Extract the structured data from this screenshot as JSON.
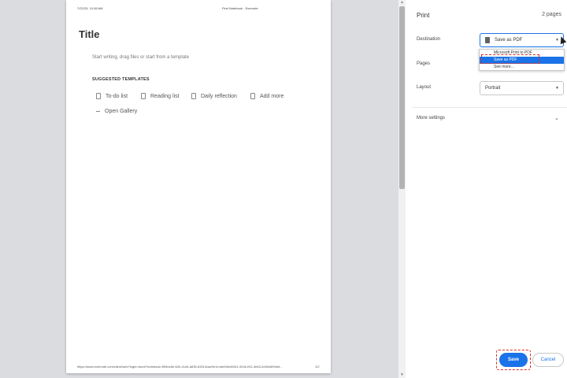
{
  "preview": {
    "header_date": "7/22/25, 10:38 AM",
    "header_title": "First Notebook - Evernote",
    "title": "Title",
    "hint": "Start writing, drag files or start from a template",
    "suggested_heading": "SUGGESTED TEMPLATES",
    "templates": [
      "To-do list",
      "Reading list",
      "Daily reflection",
      "Add more"
    ],
    "open_gallery": "Open Gallery",
    "footer_url": "https://www.evernote.com/client/web?login=true#?notebook=f0f4bc6e-62b-41d4-a635-83013cae9e1/note/06e40611-924e-ff11-3e63-2e63c6f94e6...",
    "footer_page": "1/2"
  },
  "panel": {
    "title": "Print",
    "pages_count": "2 pages",
    "destination_label": "Destination",
    "destination_value": "Save as PDF",
    "pages_label": "Pages",
    "layout_label": "Layout",
    "layout_value": "Portrait",
    "more_settings": "More settings",
    "dropdown_options": [
      "Microsoft Print to PDF",
      "Save as PDF",
      "See more..."
    ],
    "save_label": "Save",
    "cancel_label": "Cancel"
  },
  "colors": {
    "accent": "#1a73e8",
    "highlight": "#d93025"
  },
  "icons": [
    "pdf-file-icon",
    "chevron-down-icon",
    "template-doc-icon"
  ]
}
